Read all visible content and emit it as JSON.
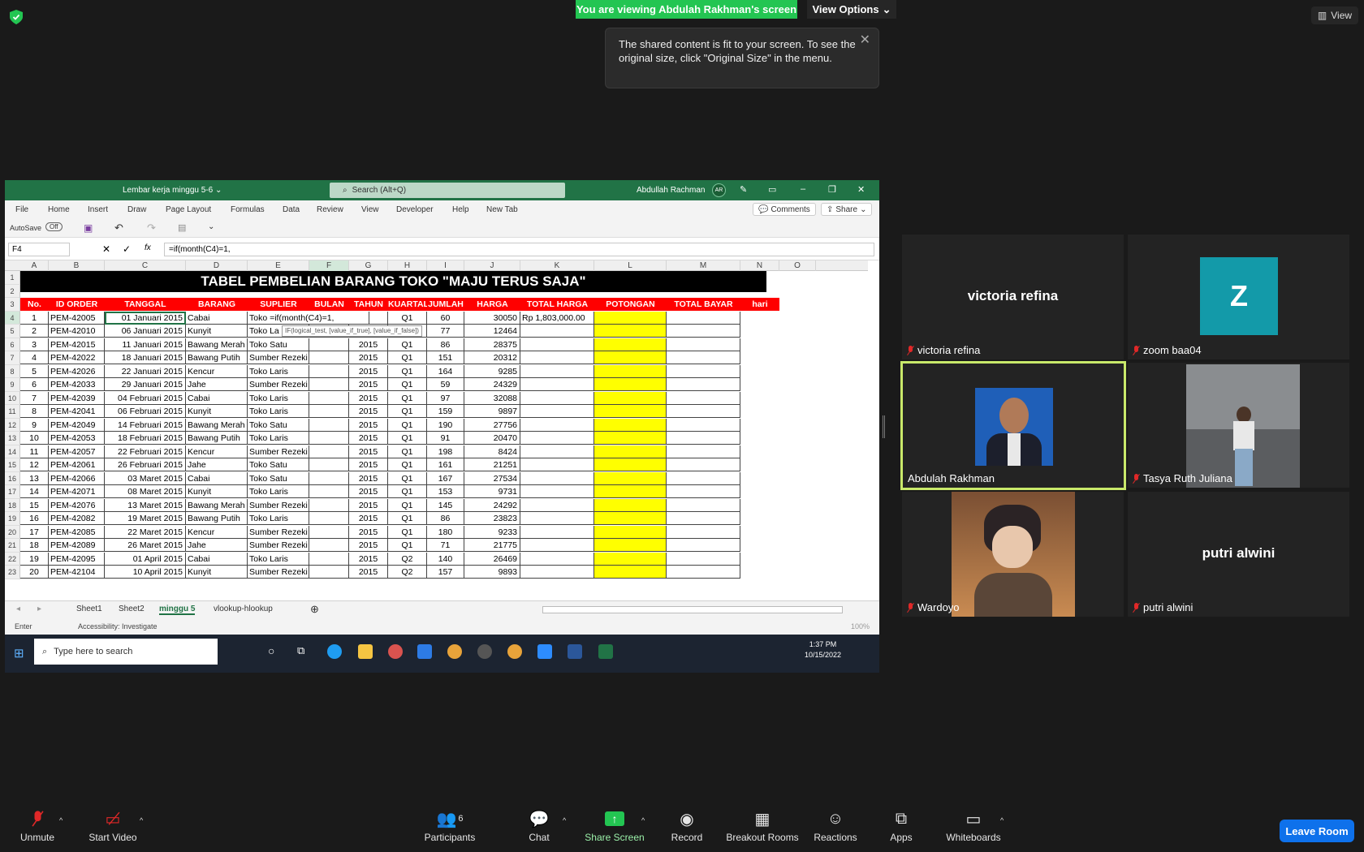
{
  "zoom": {
    "banner": "You are viewing Abdulah Rakhman's screen",
    "view_options": "View Options",
    "view_button": "View",
    "tooltip": "The shared content is fit to your screen. To see the original size, click \"Original Size\" in the menu."
  },
  "excel": {
    "doc_title": "Lembar kerja minggu 5-6",
    "search_placeholder": "Search (Alt+Q)",
    "user": "Abdullah Rachman",
    "user_initials": "AR",
    "menu": [
      "File",
      "Home",
      "Insert",
      "Draw",
      "Page Layout",
      "Formulas",
      "Data",
      "Review",
      "View",
      "Developer",
      "Help",
      "New Tab"
    ],
    "comments": "Comments",
    "share": "Share",
    "autosave": "AutoSave",
    "autosave_state": "Off",
    "name_box": "F4",
    "formula": "=if(month(C4)=1,",
    "title": "TABEL PEMBELIAN BARANG TOKO \"MAJU TERUS SAJA\"",
    "columns": [
      "A",
      "B",
      "C",
      "D",
      "E",
      "F",
      "G",
      "H",
      "I",
      "J",
      "K",
      "L",
      "M",
      "N",
      "O"
    ],
    "headers": [
      "No.",
      "ID ORDER",
      "TANGGAL",
      "BARANG",
      "SUPLIER",
      "BULAN",
      "TAHUN",
      "KUARTAL",
      "JUMLAH",
      "HARGA",
      "TOTAL HARGA",
      "POTONGAN",
      "TOTAL BAYAR",
      "hari"
    ],
    "rows": [
      [
        "1",
        "PEM-42005",
        "01 Januari 2015",
        "Cabai",
        "Toko =if(month(C4)=1,",
        "",
        "",
        "Q1",
        "60",
        "30050",
        "Rp  1,803,000.00"
      ],
      [
        "2",
        "PEM-42010",
        "06 Januari 2015",
        "Kunyit",
        "Toko La",
        "",
        "",
        "Q1",
        "77",
        "12464",
        ""
      ],
      [
        "3",
        "PEM-42015",
        "11 Januari 2015",
        "Bawang Merah",
        "Toko Satu",
        "",
        "2015",
        "Q1",
        "86",
        "28375",
        ""
      ],
      [
        "4",
        "PEM-42022",
        "18 Januari 2015",
        "Bawang Putih",
        "Sumber Rezeki",
        "",
        "2015",
        "Q1",
        "151",
        "20312",
        ""
      ],
      [
        "5",
        "PEM-42026",
        "22 Januari 2015",
        "Kencur",
        "Toko Laris",
        "",
        "2015",
        "Q1",
        "164",
        "9285",
        ""
      ],
      [
        "6",
        "PEM-42033",
        "29 Januari 2015",
        "Jahe",
        "Sumber Rezeki",
        "",
        "2015",
        "Q1",
        "59",
        "24329",
        ""
      ],
      [
        "7",
        "PEM-42039",
        "04 Februari 2015",
        "Cabai",
        "Toko Laris",
        "",
        "2015",
        "Q1",
        "97",
        "32088",
        ""
      ],
      [
        "8",
        "PEM-42041",
        "06 Februari 2015",
        "Kunyit",
        "Toko Laris",
        "",
        "2015",
        "Q1",
        "159",
        "9897",
        ""
      ],
      [
        "9",
        "PEM-42049",
        "14 Februari 2015",
        "Bawang Merah",
        "Toko Satu",
        "",
        "2015",
        "Q1",
        "190",
        "27756",
        ""
      ],
      [
        "10",
        "PEM-42053",
        "18 Februari 2015",
        "Bawang Putih",
        "Toko Laris",
        "",
        "2015",
        "Q1",
        "91",
        "20470",
        ""
      ],
      [
        "11",
        "PEM-42057",
        "22 Februari 2015",
        "Kencur",
        "Sumber Rezeki",
        "",
        "2015",
        "Q1",
        "198",
        "8424",
        ""
      ],
      [
        "12",
        "PEM-42061",
        "26 Februari 2015",
        "Jahe",
        "Toko Satu",
        "",
        "2015",
        "Q1",
        "161",
        "21251",
        ""
      ],
      [
        "13",
        "PEM-42066",
        "03 Maret 2015",
        "Cabai",
        "Toko Satu",
        "",
        "2015",
        "Q1",
        "167",
        "27534",
        ""
      ],
      [
        "14",
        "PEM-42071",
        "08 Maret 2015",
        "Kunyit",
        "Toko Laris",
        "",
        "2015",
        "Q1",
        "153",
        "9731",
        ""
      ],
      [
        "15",
        "PEM-42076",
        "13 Maret 2015",
        "Bawang Merah",
        "Sumber Rezeki",
        "",
        "2015",
        "Q1",
        "145",
        "24292",
        ""
      ],
      [
        "16",
        "PEM-42082",
        "19 Maret 2015",
        "Bawang Putih",
        "Toko Laris",
        "",
        "2015",
        "Q1",
        "86",
        "23823",
        ""
      ],
      [
        "17",
        "PEM-42085",
        "22 Maret 2015",
        "Kencur",
        "Sumber Rezeki",
        "",
        "2015",
        "Q1",
        "180",
        "9233",
        ""
      ],
      [
        "18",
        "PEM-42089",
        "26 Maret 2015",
        "Jahe",
        "Sumber Rezeki",
        "",
        "2015",
        "Q1",
        "71",
        "21775",
        ""
      ],
      [
        "19",
        "PEM-42095",
        "01 April 2015",
        "Cabai",
        "Toko Laris",
        "",
        "2015",
        "Q2",
        "140",
        "26469",
        ""
      ],
      [
        "20",
        "PEM-42104",
        "10 April 2015",
        "Kunyit",
        "Sumber Rezeki",
        "",
        "2015",
        "Q2",
        "157",
        "9893",
        ""
      ]
    ],
    "formula_tip": "IF(logical_test, [value_if_true], [value_if_false])",
    "sheets": [
      "Sheet1",
      "Sheet2",
      "minggu 5",
      "vlookup-hlookup"
    ],
    "active_sheet": "minggu 5",
    "status_mode": "Enter",
    "accessibility": "Accessibility: Investigate",
    "zoom_level": "100%"
  },
  "taskbar": {
    "search": "Type here to search",
    "time": "1:37 PM",
    "date": "10/15/2022"
  },
  "participants": [
    {
      "name": "victoria refina",
      "display": "victoria refina",
      "muted": true
    },
    {
      "name": "zoom baa04",
      "initial": "Z",
      "muted": true
    },
    {
      "name": "Abdulah Rakhman",
      "muted": false
    },
    {
      "name": "Tasya Ruth Juliana",
      "muted": true
    },
    {
      "name": "Wardoyo",
      "muted": true
    },
    {
      "name": "putri alwini",
      "display": "putri alwini",
      "muted": true
    }
  ],
  "toolbar": {
    "unmute": "Unmute",
    "start_video": "Start Video",
    "participants": "Participants",
    "participants_count": "6",
    "chat": "Chat",
    "share_screen": "Share Screen",
    "record": "Record",
    "breakout": "Breakout Rooms",
    "reactions": "Reactions",
    "apps": "Apps",
    "whiteboards": "Whiteboards",
    "leave": "Leave Room"
  },
  "colors": {
    "zoom_green": "#23c552",
    "excel_green": "#217346",
    "header_red": "#ff0000",
    "potongan_yellow": "#ffff00",
    "leave_blue": "#0e71eb"
  }
}
